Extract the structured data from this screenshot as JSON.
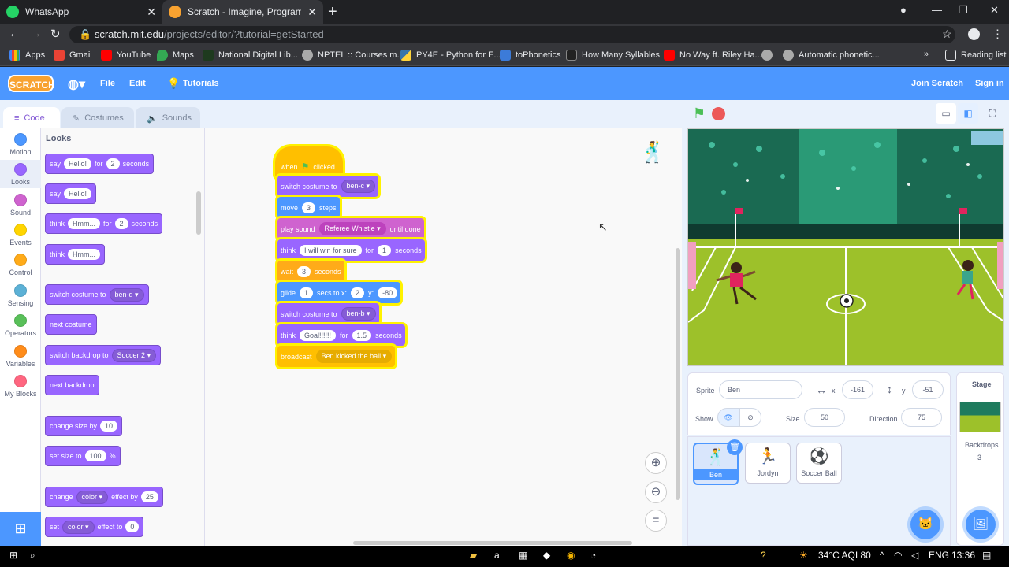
{
  "browser": {
    "tabs": [
      {
        "title": "WhatsApp",
        "active": false
      },
      {
        "title": "Scratch - Imagine, Program, Sha",
        "active": true
      }
    ],
    "url_host": "scratch.mit.edu",
    "url_path": "/projects/editor/?tutorial=getStarted",
    "bookmarks": [
      "Apps",
      "Gmail",
      "YouTube",
      "Maps",
      "National Digital Lib...",
      "NPTEL :: Courses m...",
      "PY4E - Python for E...",
      "toPhonetics",
      "How Many Syllables",
      "No Way ft. Riley Ha...",
      "",
      "Automatic phonetic..."
    ],
    "reading_list": "Reading list",
    "more": "»"
  },
  "scratch_menu": {
    "logo": "SCRATCH",
    "file": "File",
    "edit": "Edit",
    "tutorials": "Tutorials",
    "join": "Join Scratch",
    "signin": "Sign in"
  },
  "editor_tabs": {
    "code": "Code",
    "costumes": "Costumes",
    "sounds": "Sounds"
  },
  "categories": [
    {
      "label": "Motion",
      "color": "#4c97ff"
    },
    {
      "label": "Looks",
      "color": "#9966ff"
    },
    {
      "label": "Sound",
      "color": "#cf63cf"
    },
    {
      "label": "Events",
      "color": "#ffd500"
    },
    {
      "label": "Control",
      "color": "#ffab19"
    },
    {
      "label": "Sensing",
      "color": "#5cb1d6"
    },
    {
      "label": "Operators",
      "color": "#59c059"
    },
    {
      "label": "Variables",
      "color": "#ff8c1a"
    },
    {
      "label": "My Blocks",
      "color": "#ff6680"
    }
  ],
  "palette": {
    "heading": "Looks",
    "say_for": {
      "a": "say",
      "v1": "Hello!",
      "b": "for",
      "v2": "2",
      "c": "seconds"
    },
    "say": {
      "a": "say",
      "v1": "Hello!"
    },
    "think_for": {
      "a": "think",
      "v1": "Hmm...",
      "b": "for",
      "v2": "2",
      "c": "seconds"
    },
    "think": {
      "a": "think",
      "v1": "Hmm..."
    },
    "switch_costume": {
      "a": "switch costume to",
      "v1": "ben-d ▾"
    },
    "next_costume": "next costume",
    "switch_backdrop": {
      "a": "switch backdrop to",
      "v1": "Soccer 2 ▾"
    },
    "next_backdrop": "next backdrop",
    "change_size": {
      "a": "change size by",
      "v1": "10"
    },
    "set_size": {
      "a": "set size to",
      "v1": "100",
      "b": "%"
    },
    "change_effect": {
      "a": "change",
      "v1": "color ▾",
      "b": "effect by",
      "v2": "25"
    },
    "set_effect": {
      "a": "set",
      "v1": "color ▾",
      "b": "effect to",
      "v2": "0"
    }
  },
  "script": {
    "hat": {
      "a": "when",
      "b": "clicked"
    },
    "b1": {
      "a": "switch costume to",
      "v1": "ben-c ▾"
    },
    "b2": {
      "a": "move",
      "v1": "3",
      "b": "steps"
    },
    "b3": {
      "a": "play sound",
      "v1": "Referee Whistle ▾",
      "b": "until done"
    },
    "b4": {
      "a": "think",
      "v1": "I will win for sure",
      "b": "for",
      "v2": "1",
      "c": "seconds"
    },
    "b5": {
      "a": "wait",
      "v1": "3",
      "b": "seconds"
    },
    "b6": {
      "a": "glide",
      "v1": "1",
      "b": "secs to x:",
      "v2": "2",
      "c": "y:",
      "v3": "-80"
    },
    "b7": {
      "a": "switch costume to",
      "v1": "ben-b ▾"
    },
    "b8": {
      "a": "think",
      "v1": "Goal!!!!!!",
      "b": "for",
      "v2": "1.5",
      "c": "seconds"
    },
    "b9": {
      "a": "broadcast",
      "v1": "Ben kicked the ball ▾"
    }
  },
  "sprite_info": {
    "sprite_label": "Sprite",
    "sprite_name": "Ben",
    "x_label": "x",
    "x": "-161",
    "y_label": "y",
    "y": "-51",
    "show_label": "Show",
    "size_label": "Size",
    "size": "50",
    "direction_label": "Direction",
    "direction": "75"
  },
  "sprites": [
    "Ben",
    "Jordyn",
    "Soccer Ball"
  ],
  "stage_panel": {
    "title": "Stage",
    "backdrops_label": "Backdrops",
    "backdrops_count": "3"
  },
  "taskbar": {
    "weather": "34°C  AQI 80",
    "lang": "ENG",
    "time": "13:36"
  }
}
